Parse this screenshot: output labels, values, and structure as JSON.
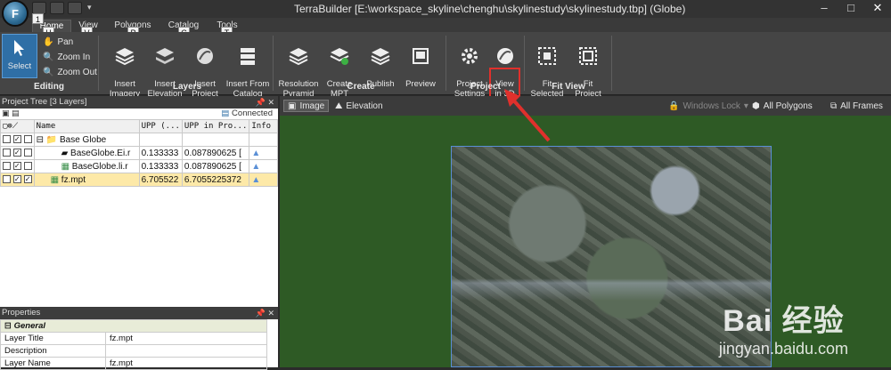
{
  "app": {
    "title": "TerraBuilder [E:\\workspace_skyline\\chenghu\\skylinestudy\\skylinestudy.tbp] (Globe)",
    "orb_letter": "F",
    "orb_badge": "1",
    "window_controls": [
      "–",
      "□",
      "✕"
    ]
  },
  "tabs": [
    {
      "label": "Home",
      "key": "H",
      "active": true
    },
    {
      "label": "View",
      "key": "V"
    },
    {
      "label": "Polygons",
      "key": "P"
    },
    {
      "label": "Catalog",
      "key": "C"
    },
    {
      "label": "Tools",
      "key": "T"
    }
  ],
  "ribbon": {
    "editing": {
      "label": "Editing",
      "select": "Select",
      "pan": "Pan",
      "zoom_in": "Zoom In",
      "zoom_out": "Zoom Out"
    },
    "layers": {
      "label": "Layers",
      "insert_imagery": "Insert\nImagery",
      "insert_elevation": "Insert\nElevation",
      "insert_project": "Insert\nProject",
      "insert_from_catalog": "Insert From\nCatalog"
    },
    "create": {
      "label": "Create",
      "resolution_pyramid": "Resolution\nPyramid",
      "create_mpt": "Create\nMPT",
      "publish": "Publish",
      "preview": "Preview"
    },
    "project": {
      "label": "Project",
      "project_settings": "Project\nSettings",
      "view_in_3d": "View\nin 3D"
    },
    "fit_view": {
      "label": "Fit View",
      "fit_selected": "Fit\nSelected",
      "fit_project": "Fit\nProject"
    }
  },
  "project_tree": {
    "header": "Project Tree [3 Layers]",
    "connected": "Connected",
    "columns": [
      "Name",
      "UPP (...",
      "UPP in Pro...",
      "Info"
    ],
    "rows": [
      {
        "name": "Base Globe",
        "upp": "",
        "upp_pro": "",
        "indent": 0,
        "type": "folder"
      },
      {
        "name": "BaseGlobe.Ei.r",
        "upp": "0.133333",
        "upp_pro": "0.087890625 [",
        "indent": 1,
        "type": "elev"
      },
      {
        "name": "BaseGlobe.li.r",
        "upp": "0.133333",
        "upp_pro": "0.087890625 [",
        "indent": 1,
        "type": "img"
      },
      {
        "name": "fz.mpt",
        "upp": "6.705522",
        "upp_pro": "6.7055225372",
        "indent": 0,
        "type": "img",
        "selected": true
      }
    ]
  },
  "properties": {
    "header": "Properties",
    "section": "General",
    "rows": [
      {
        "k": "Layer Title",
        "v": "fz.mpt"
      },
      {
        "k": "Description",
        "v": ""
      },
      {
        "k": "Layer Name",
        "v": "fz.mpt"
      }
    ]
  },
  "viewport_toolbar": {
    "image": "Image",
    "elevation": "Elevation",
    "windows_lock": "Windows Lock",
    "all_polygons": "All Polygons",
    "all_frames": "All Frames"
  },
  "watermark": {
    "main": "Bai 经验",
    "sub": "jingyan.baidu.com"
  },
  "colors": {
    "highlight": "#e0302c",
    "viewport_bg": "#2e5a25"
  }
}
